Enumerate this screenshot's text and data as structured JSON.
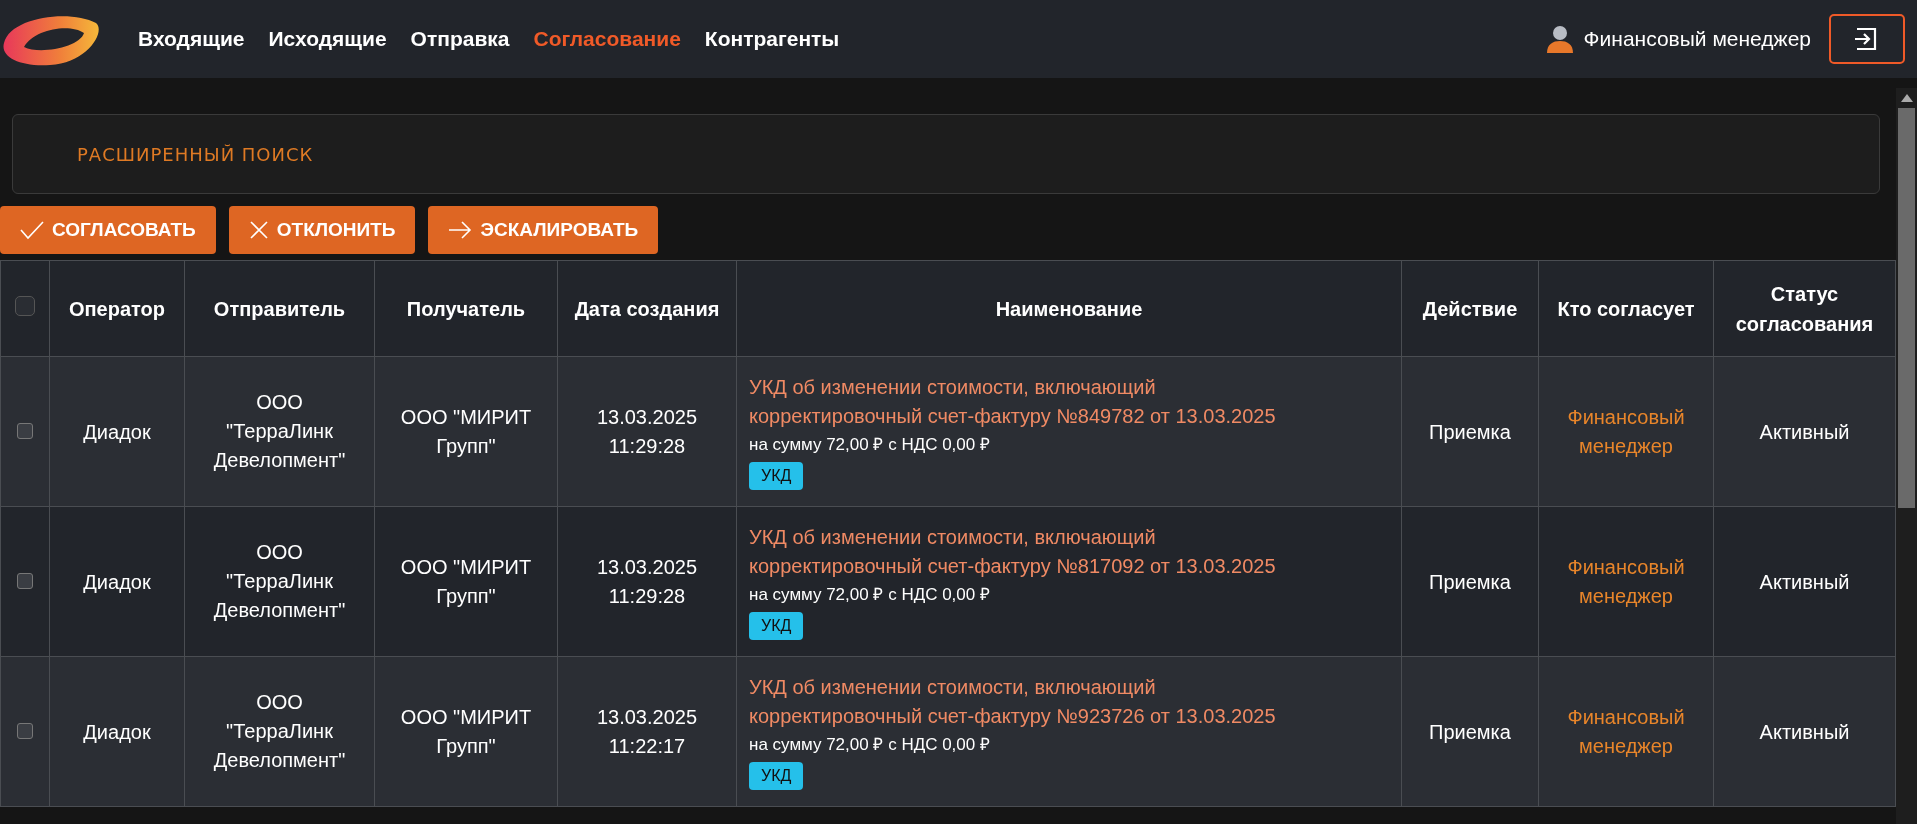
{
  "nav": [
    {
      "label": "Входящие",
      "selected": false
    },
    {
      "label": "Исходящие",
      "selected": false
    },
    {
      "label": "Отправка",
      "selected": false
    },
    {
      "label": "Согласование",
      "selected": true
    },
    {
      "label": "Контрагенты",
      "selected": false
    }
  ],
  "user": {
    "name": "Финансовый менеджер"
  },
  "search": {
    "title": "РАСШИРЕННЫЙ ПОИСК"
  },
  "actions": [
    {
      "kind": "approve",
      "label": "СОГЛАСОВАТЬ"
    },
    {
      "kind": "reject",
      "label": "ОТКЛОНИТЬ"
    },
    {
      "kind": "escalate",
      "label": "ЭСКАЛИРОВАТЬ"
    }
  ],
  "table": {
    "select_all": {
      "checked": false
    },
    "columns": [
      "Оператор",
      "Отправитель",
      "Получатель",
      "Дата создания",
      "Наименование",
      "Действие",
      "Кто согласует",
      "Статус согласования"
    ],
    "rows": [
      {
        "checked": false,
        "operator": "Диадок",
        "sender": "ООО \"ТерраЛинк Девелопмент\"",
        "recipient": "ООО \"МИРИТ Групп\"",
        "date": "13.03.2025",
        "time": "11:29:28",
        "title": "УКД об изменении стоимости, включающий корректировочный счет-фактуру №849782 от 13.03.2025",
        "amount": "на сумму 72,00 ₽ с НДС 0,00 ₽",
        "tag": "УКД",
        "action": "Приемка",
        "approver": "Финансовый менеджер",
        "status": "Активный"
      },
      {
        "checked": false,
        "operator": "Диадок",
        "sender": "ООО \"ТерраЛинк Девелопмент\"",
        "recipient": "ООО \"МИРИТ Групп\"",
        "date": "13.03.2025",
        "time": "11:29:28",
        "title": "УКД об изменении стоимости, включающий корректировочный счет-фактуру №817092 от 13.03.2025",
        "amount": "на сумму 72,00 ₽ с НДС 0,00 ₽",
        "tag": "УКД",
        "action": "Приемка",
        "approver": "Финансовый менеджер",
        "status": "Активный"
      },
      {
        "checked": false,
        "operator": "Диадок",
        "sender": "ООО \"ТерраЛинк Девелопмент\"",
        "recipient": "ООО \"МИРИТ Групп\"",
        "date": "13.03.2025",
        "time": "11:22:17",
        "title": "УКД об изменении стоимости, включающий корректировочный счет-фактуру №923726 от 13.03.2025",
        "amount": "на сумму 72,00 ₽ с НДС 0,00 ₽",
        "tag": "УКД",
        "action": "Приемка",
        "approver": "Финансовый менеджер",
        "status": "Активный"
      }
    ]
  }
}
